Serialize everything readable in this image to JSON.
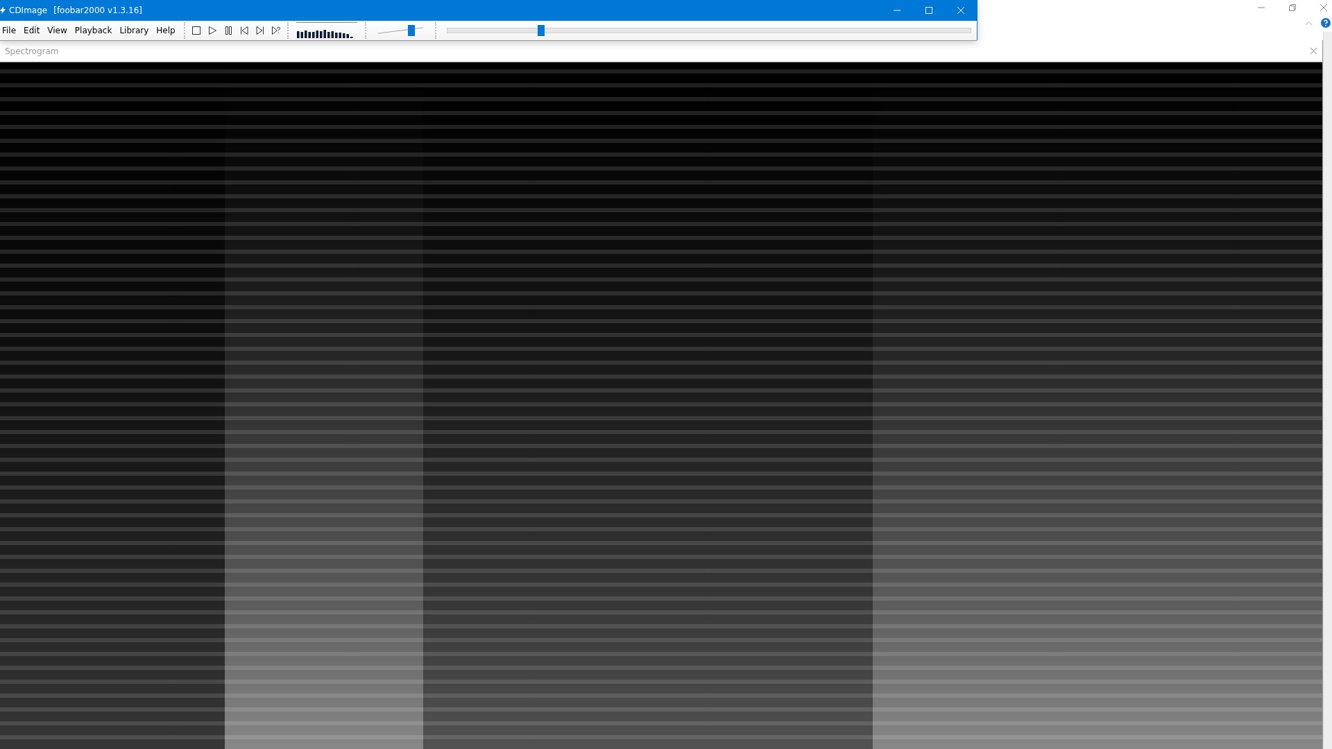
{
  "player_window": {
    "title": "CDImage",
    "subtitle": "[foobar2000 v1.3.16]",
    "menu": [
      "File",
      "Edit",
      "View",
      "Playback",
      "Library",
      "Help"
    ],
    "volume": {
      "level": 0.75
    },
    "seekbar": {
      "level": 0.18
    }
  },
  "spectrogram_window": {
    "title": "Spectrogram"
  }
}
